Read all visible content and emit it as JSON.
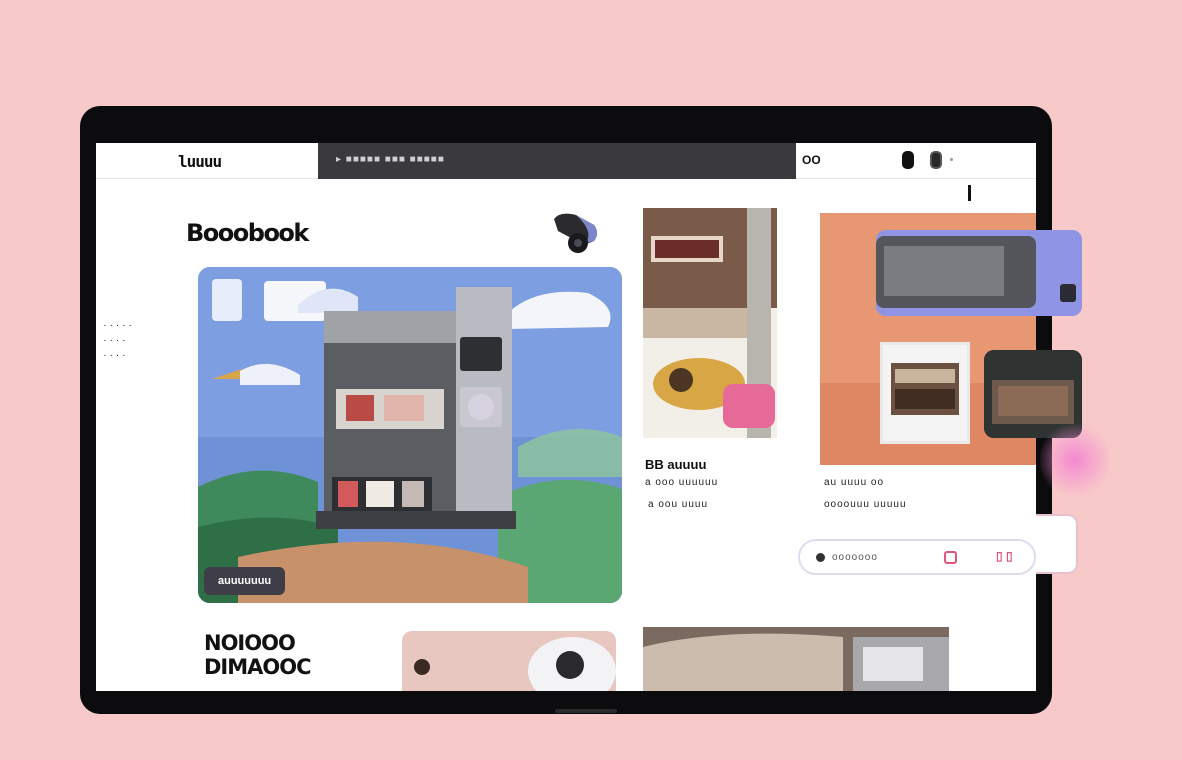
{
  "header": {
    "logo": "luuuu",
    "url": "▸ ■■■■■ ■■■ ■■■■■",
    "nav_label": "OO"
  },
  "sidebar": {
    "links": [
      "· · · · ·",
      "· · · ·",
      "· · · ·"
    ]
  },
  "main": {
    "section_title": "Booobook",
    "hero_badge": "auuuuuuu",
    "card2": {
      "title": "BB auuuu",
      "line1": "a ooo uuuuuu",
      "line2": "a oou uuuu"
    },
    "card3": {
      "line1": "au uuuu oo",
      "line2": "oooouuu uuuuu"
    },
    "pill": {
      "text": "ooooooo"
    },
    "bottom_title": [
      "NOIOOO",
      "DIMAOOC"
    ]
  },
  "colors": {
    "background": "#f8c9c9",
    "bezel": "#0c0c0e",
    "accent_pink": "#e0567a",
    "hero_sky": "#7e9ee2",
    "card_peach": "#e79873"
  }
}
